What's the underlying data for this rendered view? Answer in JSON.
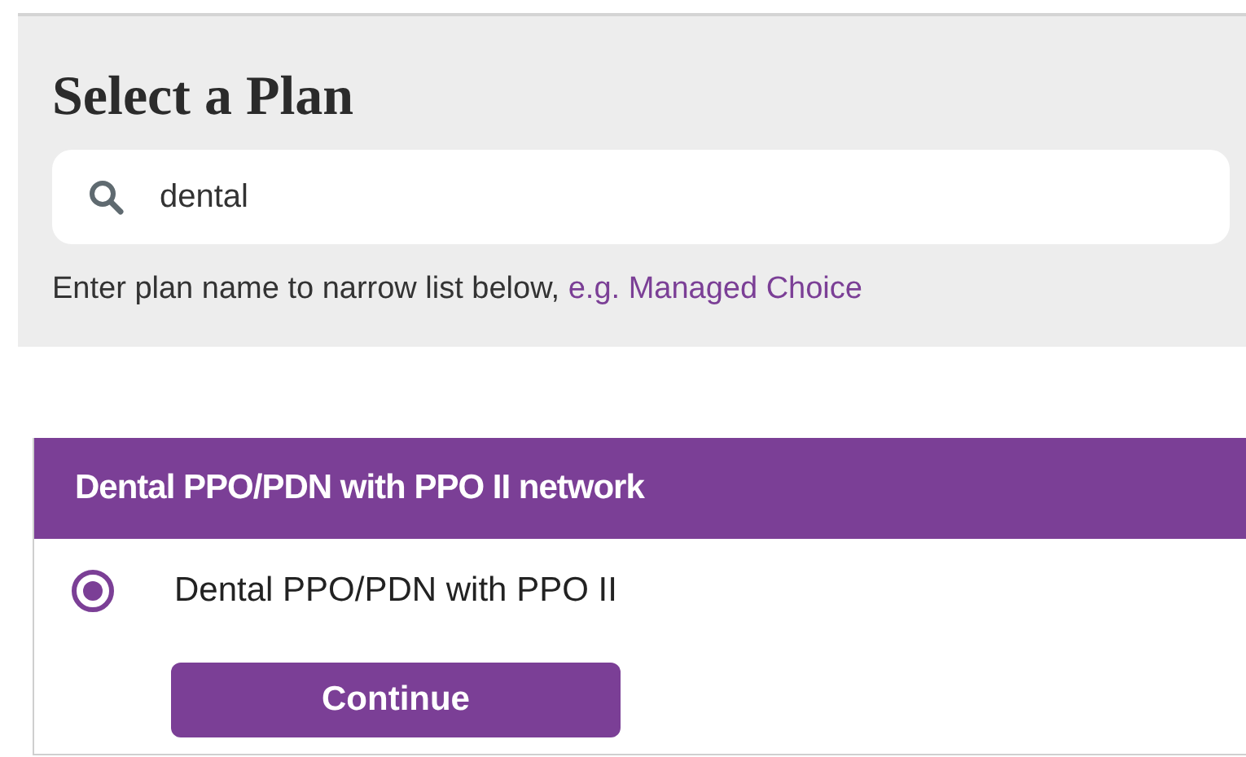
{
  "title": "Select a Plan",
  "search": {
    "value": "dental"
  },
  "hint": {
    "text": "Enter plan name to narrow list below,",
    "link": "e.g. Managed Choice"
  },
  "plan_group": {
    "heading": "Dental PPO/PDN with PPO II network",
    "options": [
      {
        "label": "Dental PPO/PDN with PPO II",
        "selected": true
      }
    ],
    "button": "Continue"
  }
}
